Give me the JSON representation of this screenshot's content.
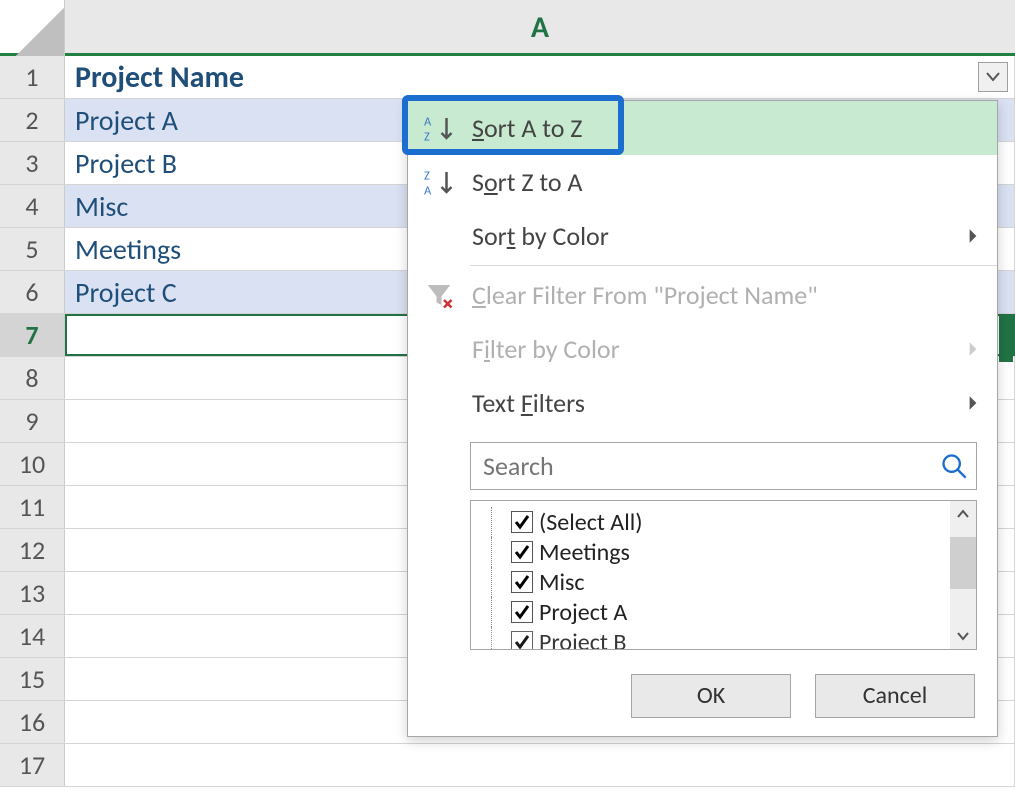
{
  "sheet": {
    "column_letter": "A",
    "header_cell": "Project Name",
    "rows": [
      "Project A",
      "Project B",
      "Misc",
      "Meetings",
      "Project C"
    ],
    "active_row": 7,
    "total_visible_rows": 17
  },
  "dropdown": {
    "sort_az": "Sort A to Z",
    "sort_za": "Sort Z to A",
    "sort_by_color": "Sort by Color",
    "clear_filter": "Clear Filter From \"Project Name\"",
    "filter_by_color": "Filter by Color",
    "text_filters": "Text Filters",
    "search_placeholder": "Search",
    "checkboxes": [
      "(Select All)",
      "Meetings",
      "Misc",
      "Project A",
      "Project B"
    ],
    "ok": "OK",
    "cancel": "Cancel"
  },
  "colors": {
    "accent_green": "#217346",
    "highlight_blue": "#1c6dd0"
  }
}
